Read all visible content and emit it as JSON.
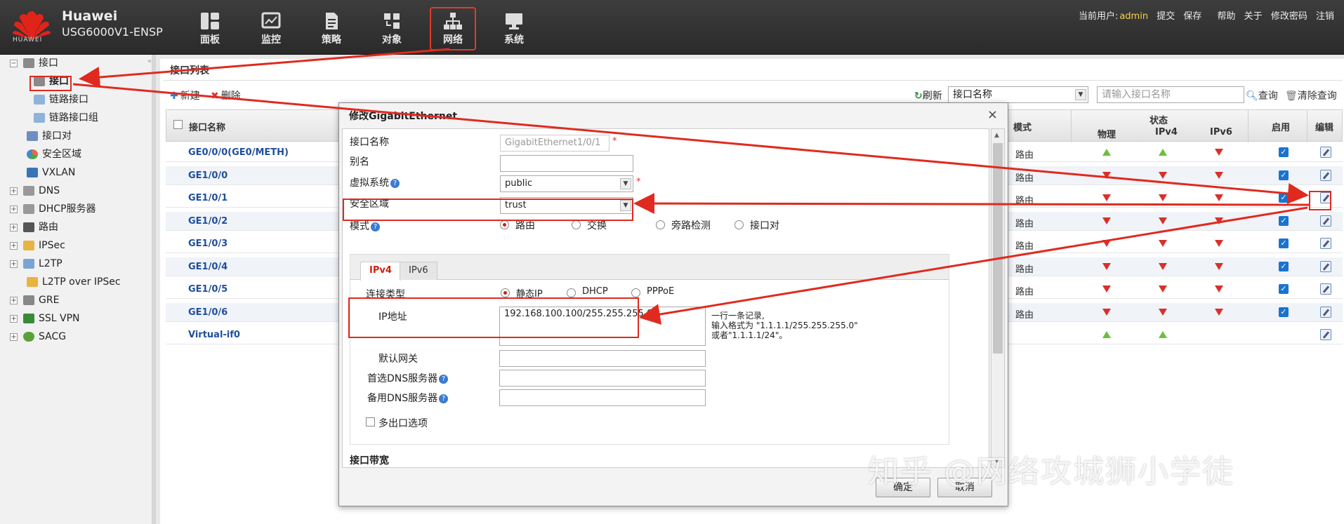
{
  "header": {
    "brand": "Huawei",
    "model": "USG6000V1-ENSP",
    "logo_text": "HUAWEI",
    "nav": [
      {
        "label": "面板",
        "icon": "dashboard-icon"
      },
      {
        "label": "监控",
        "icon": "monitor-icon"
      },
      {
        "label": "策略",
        "icon": "policy-icon"
      },
      {
        "label": "对象",
        "icon": "object-icon"
      },
      {
        "label": "网络",
        "icon": "network-icon",
        "active": true
      },
      {
        "label": "系统",
        "icon": "system-icon"
      }
    ],
    "current_user_label": "当前用户:",
    "current_user": "admin",
    "links": [
      "提交",
      "保存",
      "帮助",
      "关于",
      "修改密码",
      "注销"
    ],
    "accent": "#e23b2a"
  },
  "sidebar": {
    "items": [
      {
        "label": "接口",
        "level": 0,
        "expand": "−"
      },
      {
        "label": "接口",
        "level": 1,
        "selected": true
      },
      {
        "label": "链路接口",
        "level": 1
      },
      {
        "label": "链路接口组",
        "level": 1
      },
      {
        "label": "接口对",
        "level": 0
      },
      {
        "label": "安全区域",
        "level": 0
      },
      {
        "label": "VXLAN",
        "level": 0
      },
      {
        "label": "DNS",
        "level": 0,
        "expand": "+"
      },
      {
        "label": "DHCP服务器",
        "level": 0,
        "expand": "+"
      },
      {
        "label": "路由",
        "level": 0,
        "expand": "+"
      },
      {
        "label": "IPSec",
        "level": 0,
        "expand": "+"
      },
      {
        "label": "L2TP",
        "level": 0,
        "expand": "+"
      },
      {
        "label": "L2TP over IPSec",
        "level": 0
      },
      {
        "label": "GRE",
        "level": 0,
        "expand": "+"
      },
      {
        "label": "SSL VPN",
        "level": 0,
        "expand": "+"
      },
      {
        "label": "SACG",
        "level": 0,
        "expand": "+"
      }
    ]
  },
  "main": {
    "title": "接口列表",
    "new_label": "新建",
    "delete_label": "删除",
    "refresh_label": "刷新",
    "filter_select": "接口名称",
    "search_placeholder": "请输入接口名称",
    "query_label": "查询",
    "clear_label": "清除查询",
    "columns": {
      "name": "接口名称",
      "mode": "模式",
      "status": "状态",
      "physical": "物理",
      "ipv4": "IPv4",
      "ipv6": "IPv6",
      "enable": "启用",
      "edit": "编辑"
    },
    "rows": [
      {
        "name": "GE0/0/0(GE0/METH)",
        "mode": "路由",
        "phy": "up",
        "v4": "up",
        "v6": "down",
        "enabled": true
      },
      {
        "name": "GE1/0/0",
        "mode": "路由",
        "phy": "down",
        "v4": "down",
        "v6": "down",
        "enabled": true
      },
      {
        "name": "GE1/0/1",
        "mode": "路由",
        "phy": "down",
        "v4": "down",
        "v6": "down",
        "enabled": true
      },
      {
        "name": "GE1/0/2",
        "mode": "路由",
        "phy": "down",
        "v4": "down",
        "v6": "down",
        "enabled": true
      },
      {
        "name": "GE1/0/3",
        "mode": "路由",
        "phy": "down",
        "v4": "down",
        "v6": "down",
        "enabled": true
      },
      {
        "name": "GE1/0/4",
        "mode": "路由",
        "phy": "down",
        "v4": "down",
        "v6": "down",
        "enabled": true
      },
      {
        "name": "GE1/0/5",
        "mode": "路由",
        "phy": "down",
        "v4": "down",
        "v6": "down",
        "enabled": true
      },
      {
        "name": "GE1/0/6",
        "mode": "路由",
        "phy": "down",
        "v4": "down",
        "v6": "down",
        "enabled": true
      },
      {
        "name": "Virtual-if0",
        "mode": "",
        "phy": "up",
        "v4": "up",
        "v6": "",
        "enabled": false
      }
    ],
    "up_color": "#6cbf3a",
    "down_color": "#d9302a"
  },
  "dialog": {
    "title": "修改GigabitEthernet",
    "close": "×",
    "fields": {
      "name_label": "接口名称",
      "name_value": "GigabitEthernet1/0/1",
      "alias_label": "别名",
      "alias_value": "",
      "vsys_label": "虚拟系统",
      "vsys_value": "public",
      "zone_label": "安全区域",
      "zone_value": "trust",
      "mode_label": "模式",
      "mode_options": [
        "路由",
        "交换",
        "旁路检测",
        "接口对"
      ],
      "tab_ipv4": "IPv4",
      "tab_ipv6": "IPv6",
      "conn_label": "连接类型",
      "conn_options": [
        "静态IP",
        "DHCP",
        "PPPoE"
      ],
      "ip_label": "IP地址",
      "ip_value": "192.168.100.100/255.255.255.0",
      "ip_hint_1": "一行一条记录,",
      "ip_hint_2": "输入格式为 \"1.1.1.1/255.255.255.0\"",
      "ip_hint_3": "或者\"1.1.1.1/24\"。",
      "gw_label": "默认网关",
      "dns1_label": "首选DNS服务器",
      "dns2_label": "备用DNS服务器",
      "multi_exit_label": "多出口选项",
      "bandwidth_label": "接口带宽"
    },
    "ok_label": "确定",
    "cancel_label": "取消",
    "required_mark": "*",
    "help_mark": "?"
  },
  "watermark": "知乎 @网络攻城狮小学徒"
}
